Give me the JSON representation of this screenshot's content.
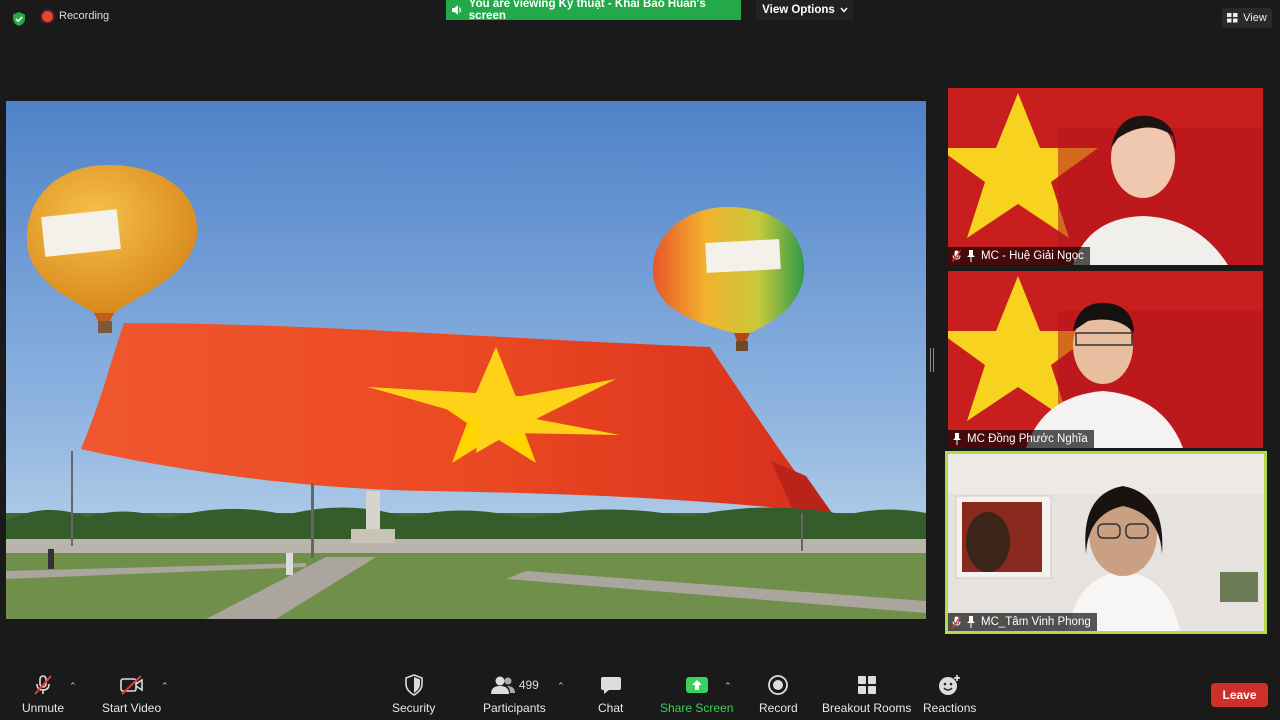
{
  "top_bar": {
    "recording_label": "Recording",
    "viewing_banner": "You are viewing Kỹ thuật - Khải Bảo Huấn's screen",
    "view_options_label": "View Options",
    "view_label": "View"
  },
  "participants_tiles": [
    {
      "name": "MC - Huệ Giải Ngọc"
    },
    {
      "name": "MC Đồng Phước Nghĩa"
    },
    {
      "name": "MC_Tâm Vinh Phong"
    }
  ],
  "toolbar": {
    "unmute_label": "Unmute",
    "start_video_label": "Start Video",
    "security_label": "Security",
    "participants_label": "Participants",
    "participants_count": "499",
    "chat_label": "Chat",
    "share_screen_label": "Share Screen",
    "record_label": "Record",
    "breakout_rooms_label": "Breakout Rooms",
    "reactions_label": "Reactions",
    "leave_label": "Leave"
  },
  "colors": {
    "banner_green": "#23a94a",
    "share_green": "#3ad15a",
    "leave_red": "#d0302a",
    "active_speaker_border": "#b4d94c",
    "flag_red": "#da251d",
    "flag_star": "#ffd400"
  }
}
